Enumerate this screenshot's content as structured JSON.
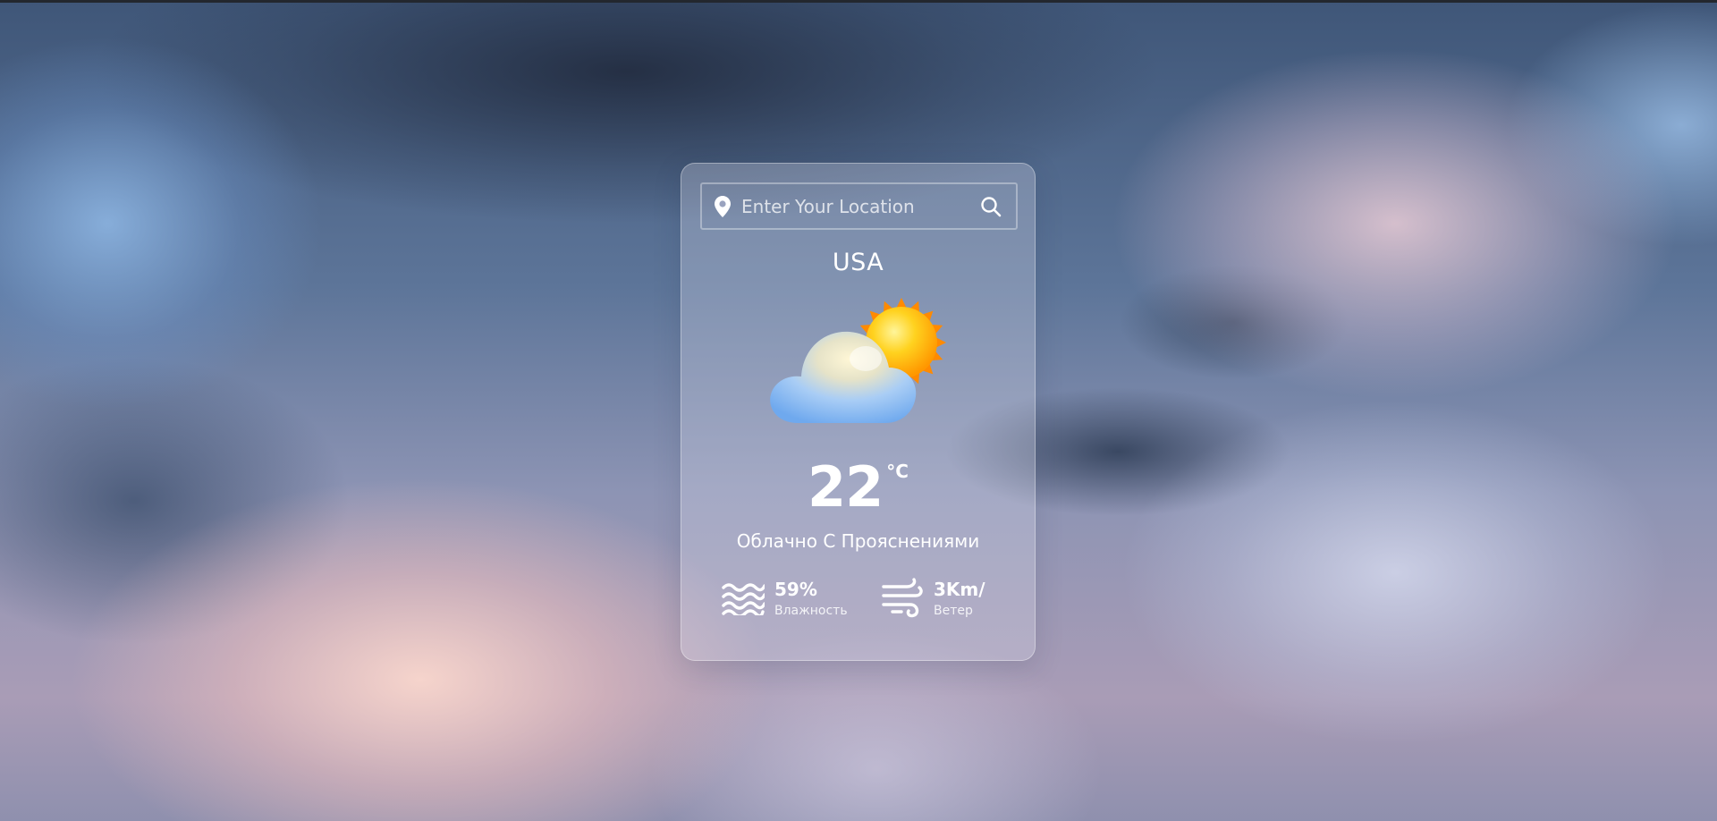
{
  "search": {
    "placeholder": "Enter Your Location",
    "value": ""
  },
  "weather": {
    "location": "USA",
    "temperature": "22",
    "unit": "°C",
    "description": "Облачно С Прояснениями",
    "icon": "partly-cloudy-icon"
  },
  "details": {
    "humidity": {
      "value": "59%",
      "label": "Влажность",
      "icon": "waves-icon"
    },
    "wind": {
      "value": "3Km/",
      "label": "Ветер",
      "icon": "wind-icon"
    }
  },
  "icons": {
    "location": "location-pin-icon",
    "search": "search-icon"
  },
  "colors": {
    "card_border": "#ffffff",
    "text": "#ffffff",
    "sun": "#ffb300",
    "cloud": "#8ec4ff"
  }
}
